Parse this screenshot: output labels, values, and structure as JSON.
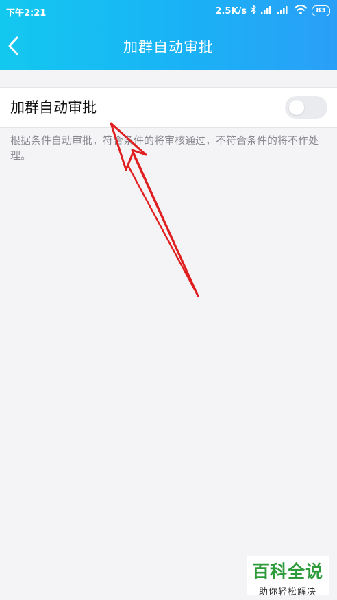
{
  "status_bar": {
    "time": "下午2:21",
    "net_speed": "2.5K/s",
    "battery": "83",
    "icons": [
      "bluetooth-icon",
      "signal-icon",
      "signal-icon",
      "wifi-icon",
      "battery-icon"
    ]
  },
  "header": {
    "title": "加群自动审批",
    "back_icon": "chevron-left-icon"
  },
  "setting": {
    "label": "加群自动审批",
    "enabled": false
  },
  "description": "根据条件自动审批，符合条件的将审核通过，不符合条件的将不作处理。",
  "watermark": {
    "main": "百科全说",
    "sub": "助你轻松解决"
  },
  "colors": {
    "header_gradient_start": "#13c8ef",
    "header_gradient_end": "#2a9ff7",
    "annotation_arrow": "#e02020",
    "watermark_green": "#2e9b3a"
  }
}
